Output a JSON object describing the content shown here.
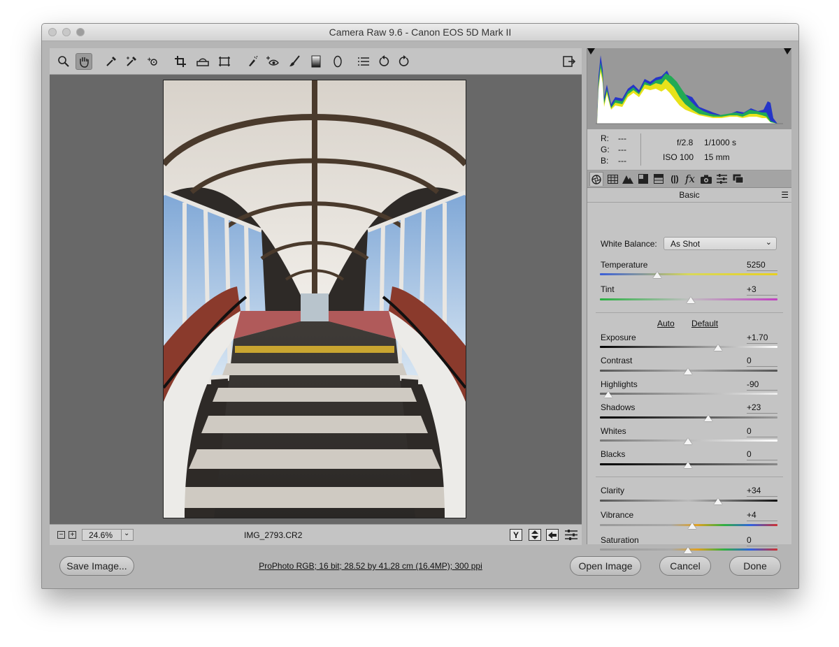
{
  "window": {
    "title": "Camera Raw 9.6  -  Canon EOS 5D Mark II"
  },
  "toolbar": {
    "tools": [
      "zoom-tool",
      "hand-tool",
      "white-balance-tool",
      "color-sampler-tool",
      "targeted-adjustment-tool",
      "crop-tool",
      "straighten-tool",
      "transform-tool",
      "spot-removal-tool",
      "red-eye-removal-tool",
      "adjustment-brush",
      "graduated-filter",
      "radial-filter",
      "preferences",
      "rotate-left",
      "rotate-right"
    ],
    "fullscreen_icon": "fullscreen-toggle-icon"
  },
  "status": {
    "zoom_value": "24.6%",
    "filename": "IMG_2793.CR2",
    "before_after_label": "Y"
  },
  "camera_info": {
    "r_label": "R:",
    "r_value": "---",
    "g_label": "G:",
    "g_value": "---",
    "b_label": "B:",
    "b_value": "---",
    "aperture": "f/2.8",
    "shutter": "1/1000 s",
    "iso": "ISO 100",
    "focal": "15 mm"
  },
  "panel": {
    "title": "Basic",
    "white_balance_label": "White Balance:",
    "white_balance_value": "As Shot",
    "auto_label": "Auto",
    "default_label": "Default"
  },
  "sliders": {
    "temperature": {
      "label": "Temperature",
      "value": "5250"
    },
    "tint": {
      "label": "Tint",
      "value": "+3"
    },
    "exposure": {
      "label": "Exposure",
      "value": "+1.70"
    },
    "contrast": {
      "label": "Contrast",
      "value": "0"
    },
    "highlights": {
      "label": "Highlights",
      "value": "-90"
    },
    "shadows": {
      "label": "Shadows",
      "value": "+23"
    },
    "whites": {
      "label": "Whites",
      "value": "0"
    },
    "blacks": {
      "label": "Blacks",
      "value": "0"
    },
    "clarity": {
      "label": "Clarity",
      "value": "+34"
    },
    "vibrance": {
      "label": "Vibrance",
      "value": "+4"
    },
    "saturation": {
      "label": "Saturation",
      "value": "0"
    }
  },
  "footer": {
    "save_label": "Save Image...",
    "workflow_label": "ProPhoto RGB; 16 bit; 28.52 by 41.28 cm (16.4MP); 300 ppi",
    "open_label": "Open Image",
    "cancel_label": "Cancel",
    "done_label": "Done"
  },
  "colors": {
    "window_bg": "#b5b5b5",
    "preview_bg": "#686868",
    "panel_bg": "#c4c4c4",
    "histogram_bg": "#999999"
  }
}
